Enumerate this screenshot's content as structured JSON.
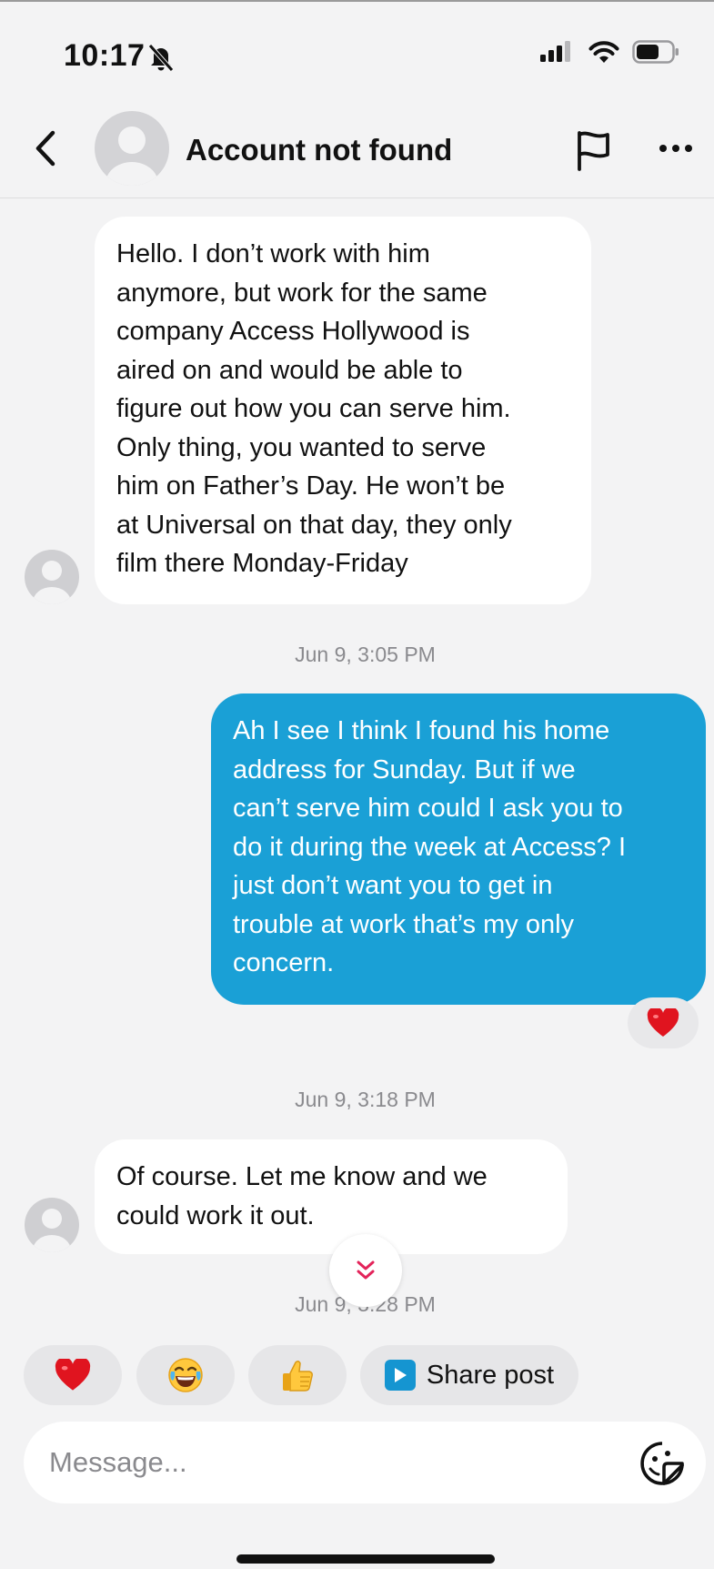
{
  "status_bar": {
    "time": "10:17",
    "icons": [
      "bell-off-icon",
      "signal-icon",
      "wifi-icon",
      "battery-icon"
    ]
  },
  "header": {
    "title": "Account not found",
    "icons": [
      "back-chevron-icon",
      "avatar",
      "flag-icon",
      "more-icon"
    ]
  },
  "messages": [
    {
      "direction": "incoming",
      "lines": [
        "Hello. I don’t work with him",
        "anymore, but work for the same",
        "company Access Hollywood is",
        "aired on and would be able to",
        "figure out how you can serve him.",
        "Only thing, you wanted to serve",
        "him on Father’s Day. He won’t be",
        "at Universal on that day, they only",
        "film there Monday-Friday"
      ]
    },
    {
      "direction": "outgoing",
      "lines": [
        "Ah I see I think I found his home",
        "address for Sunday. But if we",
        "can’t serve him could I ask you to",
        "do it during the week at Access? I",
        "just don’t want you to get in",
        "trouble at work that’s my only",
        "concern."
      ],
      "reaction": "heart"
    },
    {
      "direction": "incoming",
      "lines": [
        "Of course. Let me know and we",
        "could work it out."
      ]
    }
  ],
  "timestamps": [
    "Jun 9, 3:05 PM",
    "Jun 9, 3:18 PM",
    "Jun 9, 3:28 PM"
  ],
  "quick_replies": {
    "reactions": [
      "heart-emoji",
      "laughing-emoji",
      "thumbs-up-emoji"
    ],
    "share_label": "Share post"
  },
  "composer": {
    "placeholder": "Message..."
  },
  "colors": {
    "background": "#f3f3f4",
    "incoming_bubble": "#ffffff",
    "outgoing_bubble": "#1aa0d6",
    "timestamp_text": "#8a8a8e",
    "heart": "#e0141f",
    "accent_pink": "#e3245a"
  }
}
